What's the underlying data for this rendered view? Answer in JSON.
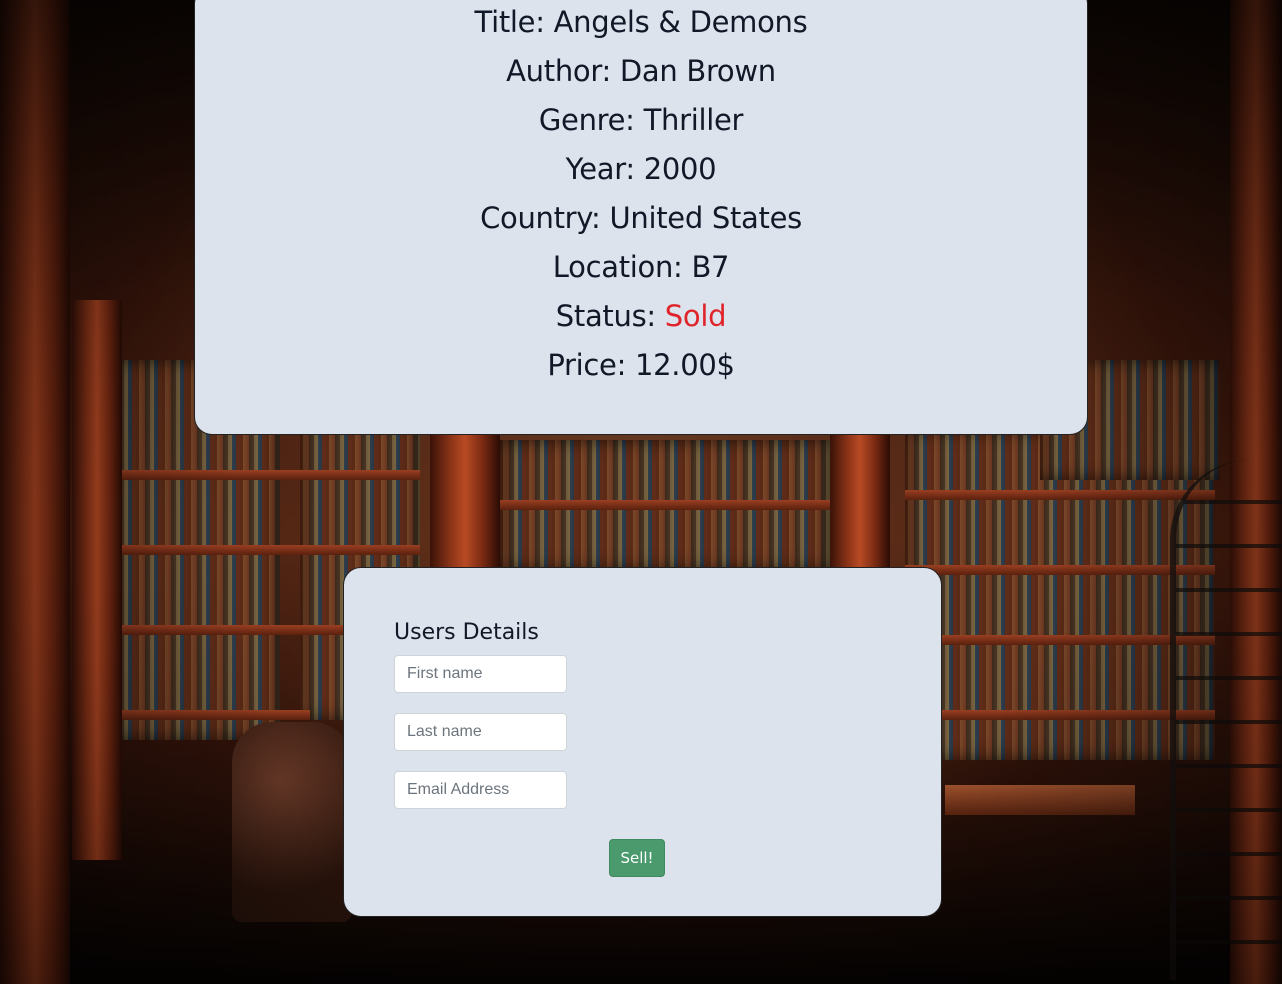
{
  "book": {
    "title_label": "Title:",
    "title_value": "Angels & Demons",
    "author_label": "Author:",
    "author_value": "Dan Brown",
    "genre_label": "Genre:",
    "genre_value": "Thriller",
    "year_label": "Year:",
    "year_value": "2000",
    "country_label": "Country:",
    "country_value": "United States",
    "location_label": "Location:",
    "location_value": "B7",
    "status_label": "Status:",
    "status_value": "Sold",
    "status_color": "#e0242b",
    "price_label": "Price:",
    "price_value": "12.00$"
  },
  "users_form": {
    "heading": "Users Details",
    "first_name_placeholder": "First name",
    "last_name_placeholder": "Last name",
    "email_placeholder": "Email Address",
    "submit_label": "Sell!",
    "submit_color": "#4a9a6e"
  },
  "colors": {
    "card_background": "#dce3ec"
  }
}
